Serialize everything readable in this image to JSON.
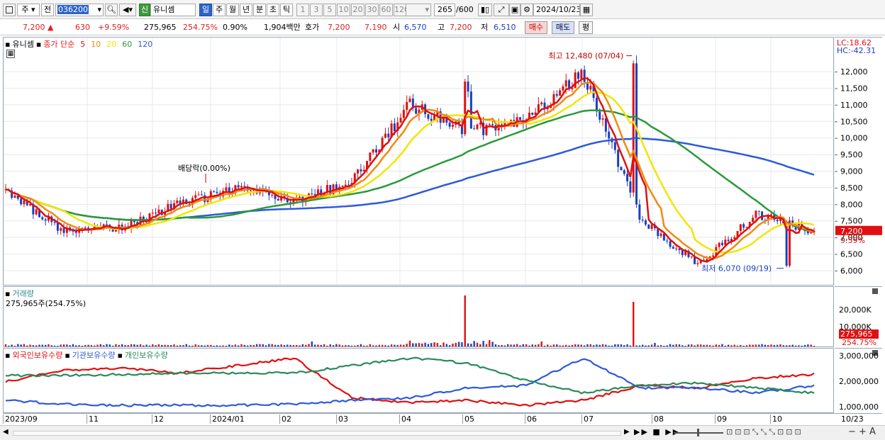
{
  "toolbar": {
    "period_label": "주",
    "prev_label": "전",
    "code": "036200",
    "name_badge": "신",
    "name": "유니셈",
    "intervals": [
      "일",
      "주",
      "월",
      "년",
      "분",
      "초",
      "틱"
    ],
    "intervals_active": "일",
    "minute_buttons": [
      "1",
      "3",
      "5",
      "10",
      "20",
      "30",
      "60",
      "120"
    ],
    "count_value": "265",
    "count_total": "/600",
    "date": "2024/10/23"
  },
  "quote": {
    "price": "7,200",
    "arrow": "▲",
    "change": "630",
    "change_pct": "+9.59%",
    "volume": "275,965",
    "volume_ratio": "254.75%",
    "turnover": "0.90%",
    "amount": "1,904백만",
    "ask_label": "호가",
    "ask": "7,200",
    "bid": "7,190",
    "open_label": "시",
    "open": "6,570",
    "high_label": "고",
    "high": "7,200",
    "low_label": "저",
    "low": "6,510",
    "buy_button": "매수",
    "sell_button": "매도",
    "eval_button": "평"
  },
  "price_pane": {
    "stock_label": "유니셈",
    "ma_title": "종가 단순",
    "ma_periods": [
      "5",
      "10",
      "20",
      "60",
      "120"
    ],
    "ma_colors": [
      "#e01010",
      "#f08a10",
      "#f2e600",
      "#2a9a3a",
      "#2e5ad8"
    ],
    "lc": "LC:18.62",
    "hc": "HC:-42.31",
    "high_annotation": "최고 12,480 (07/04)",
    "low_annotation": "최저 6,070 (09/19)",
    "dividend_annotation": "배당락(0.00%)",
    "current_price_tag": "7,200",
    "current_pct_tag": "9.59%"
  },
  "volume_pane": {
    "title": "거래량",
    "info": "275,965주(254.75%)",
    "axis_ticks": [
      "20,000K",
      "10,000K"
    ],
    "current_tag": "275,965",
    "current_pct": "254.75%"
  },
  "holding_pane": {
    "legend": [
      "외국인보유수량",
      "기관보유수량",
      "개인보유수량"
    ],
    "legend_colors": [
      "#e01010",
      "#2e5ad8",
      "#2a8a5a"
    ],
    "axis_ticks": [
      "3,000,000",
      "2,000,000",
      "1,000,000"
    ]
  },
  "x_axis": {
    "labels": [
      "2023/09",
      "11",
      "12",
      "2024/01",
      "02",
      "03",
      "04",
      "05",
      "06",
      "07",
      "08",
      "09",
      "10",
      "10/23"
    ]
  },
  "chart_data": {
    "type": "candlestick",
    "y_axis_ticks": [
      12000,
      11500,
      11000,
      10500,
      10000,
      9500,
      9000,
      8500,
      8000,
      7500,
      7000,
      6500,
      6000
    ],
    "ylim": [
      5700,
      12600
    ],
    "x_range": [
      "2023/09",
      "2024/10/23"
    ],
    "close_path": [
      {
        "t": "2023/09",
        "close": 8400
      },
      {
        "t": "2023/10",
        "close": 7200
      },
      {
        "t": "2023/11",
        "close": 7300
      },
      {
        "t": "2023/12",
        "close": 8000
      },
      {
        "t": "2024/01",
        "close": 8500
      },
      {
        "t": "2024/02",
        "close": 8100
      },
      {
        "t": "2024/03",
        "close": 8700
      },
      {
        "t": "2024/04",
        "close": 11000
      },
      {
        "t": "2024/05",
        "close": 10200
      },
      {
        "t": "2024/06",
        "close": 10500
      },
      {
        "t": "2024/07",
        "close": 12000
      },
      {
        "t": "2024/08",
        "close": 7500
      },
      {
        "t": "2024/09",
        "close": 6200
      },
      {
        "t": "2024/10",
        "close": 7700
      },
      {
        "t": "2024/10/23",
        "close": 7200
      }
    ],
    "high": {
      "value": 12480,
      "date": "07/04"
    },
    "low": {
      "value": 6070,
      "date": "09/19"
    },
    "last": {
      "close": 7200,
      "change_pct": 9.59
    }
  }
}
